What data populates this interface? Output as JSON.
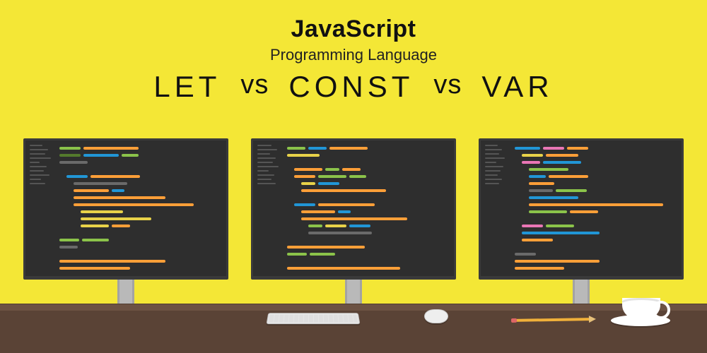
{
  "header": {
    "title": "JavaScript",
    "subtitle": "Programming Language",
    "kw1": "LET",
    "vs1": "vs",
    "kw2": "CONST",
    "vs2": "vs",
    "kw3": "VAR"
  },
  "colors": {
    "background": "#f4e736",
    "desk": "#5a4336",
    "screen": "#2e2e2e",
    "orange": "#ff9f38",
    "green": "#8bc34a",
    "blue": "#2196d6",
    "yellow": "#e8d249",
    "pink": "#e976b5"
  }
}
